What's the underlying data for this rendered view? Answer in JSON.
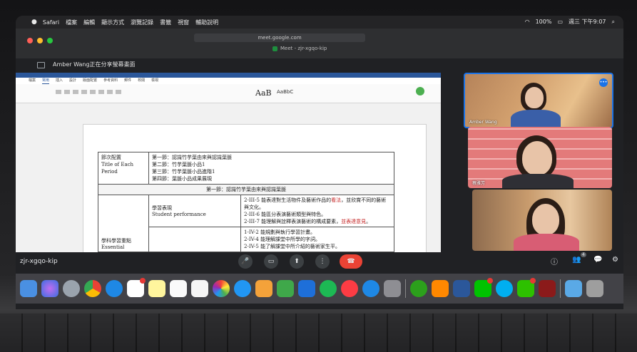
{
  "menubar": {
    "apple": "",
    "items": [
      "Safari",
      "檔案",
      "編輯",
      "顯示方式",
      "瀏覽記錄",
      "書籤",
      "視窗",
      "輔助說明"
    ],
    "battery": "100%",
    "clock": "週三 下午9:07"
  },
  "browser": {
    "url": "meet.google.com",
    "tab_title": "Meet - zjr-xgqo-kip"
  },
  "presenting": {
    "text": "Amber Wang正在分享螢幕畫面"
  },
  "document": {
    "title_bar": "",
    "ribbon_tabs": [
      "檔案",
      "常用",
      "插入",
      "設計",
      "版面配置",
      "參考資料",
      "郵件",
      "校閱",
      "檢視"
    ],
    "style_sample_1": "AaB",
    "style_sample_2": "AaBbC",
    "row1_label_zh": "節次配置",
    "row1_label_en": "Title of Each Period",
    "row1_items": [
      "第一節：認識竹芋葉由來與認識葉脈",
      "第二節：竹芋葉脈小品1",
      "第三節：竹芋葉脈小品進階1",
      "第四節：葉脈小品成果展現"
    ],
    "section_header": "第一節：認識竹芋葉由來與認識葉脈",
    "perf_zh": "學習表現",
    "perf_en": "Student performance",
    "indicators": [
      {
        "code": "2-III-5",
        "text_a": "能表達對生活物件及藝術作品的",
        "red": "看法",
        "text_b": "，並欣賞不同的藝術與文化。"
      },
      {
        "code": "2-III-6",
        "text_a": "能區分表演藝術類型與特色。",
        "red": "",
        "text_b": ""
      },
      {
        "code": "2-III-7",
        "text_a": "能理解與詮釋表演藝術的構成要素，",
        "red": "並表達意見",
        "text_b": "。"
      }
    ],
    "focus_zh": "學科學習重點",
    "focus_en": "Essential",
    "more_items": [
      {
        "code": "1-IV-2",
        "text": "能規劃與執行學習計畫。"
      },
      {
        "code": "2-IV-4",
        "text": "能理解課堂中所學的字詞。"
      },
      {
        "code": "2-IV-5",
        "text": "能了解課堂中所介紹的藝術家生平。"
      }
    ]
  },
  "participants": [
    {
      "name": "Amber Wang"
    },
    {
      "name": "蔡雅芳"
    },
    {
      "name": ""
    }
  ],
  "meeting_code": "zjr-xgqo-kip",
  "controls": {
    "mic": "🎤",
    "camera": "▭",
    "present": "⬆",
    "more": "⋮",
    "end": "☎",
    "info": "ⓘ",
    "people": "👥",
    "people_count": "4",
    "chat": "💬",
    "activities": "⚙"
  },
  "dock_icons": [
    "finder-icon",
    "siri-icon",
    "launchpad-icon",
    "chrome-icon",
    "safari-icon",
    "calendar-icon",
    "notes-icon",
    "reminders-icon",
    "photos-icon",
    "messages-icon",
    "facetime-icon",
    "pages-icon",
    "numbers-icon",
    "keynote-icon",
    "spotify-icon",
    "music-icon",
    "appstore-icon",
    "settings-icon",
    "qb-icon",
    "vlc-icon",
    "word-icon",
    "line-icon",
    "skype-icon",
    "wechat-icon",
    "flash-icon",
    "folder-icon",
    "trash-icon"
  ]
}
